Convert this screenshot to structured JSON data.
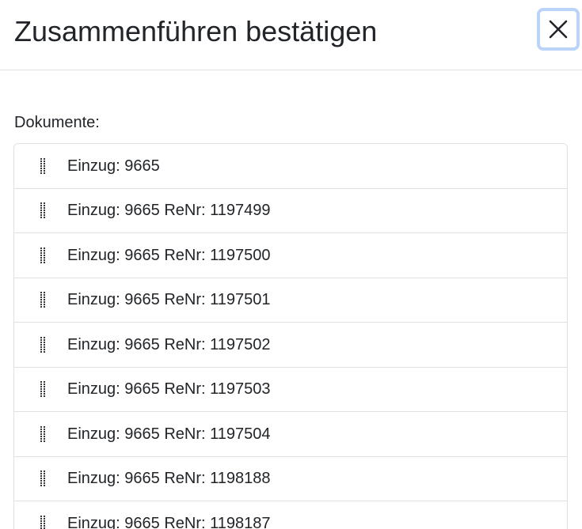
{
  "modal": {
    "title": "Zusammenführen bestätigen",
    "close_icon": "close-icon"
  },
  "documents": {
    "label": "Dokumente:",
    "handle_icon": "drag-handle-icon",
    "items": [
      {
        "label": "Einzug: 9665"
      },
      {
        "label": "Einzug: 9665 ReNr: 1197499"
      },
      {
        "label": "Einzug: 9665 ReNr: 1197500"
      },
      {
        "label": "Einzug: 9665 ReNr: 1197501"
      },
      {
        "label": "Einzug: 9665 ReNr: 1197502"
      },
      {
        "label": "Einzug: 9665 ReNr: 1197503"
      },
      {
        "label": "Einzug: 9665 ReNr: 1197504"
      },
      {
        "label": "Einzug: 9665 ReNr: 1198188"
      },
      {
        "label": "Einzug: 9665 ReNr: 1198187"
      }
    ]
  },
  "colors": {
    "border": "#dee2e6",
    "text": "#212529",
    "focus_ring": "#b9d4f7"
  }
}
